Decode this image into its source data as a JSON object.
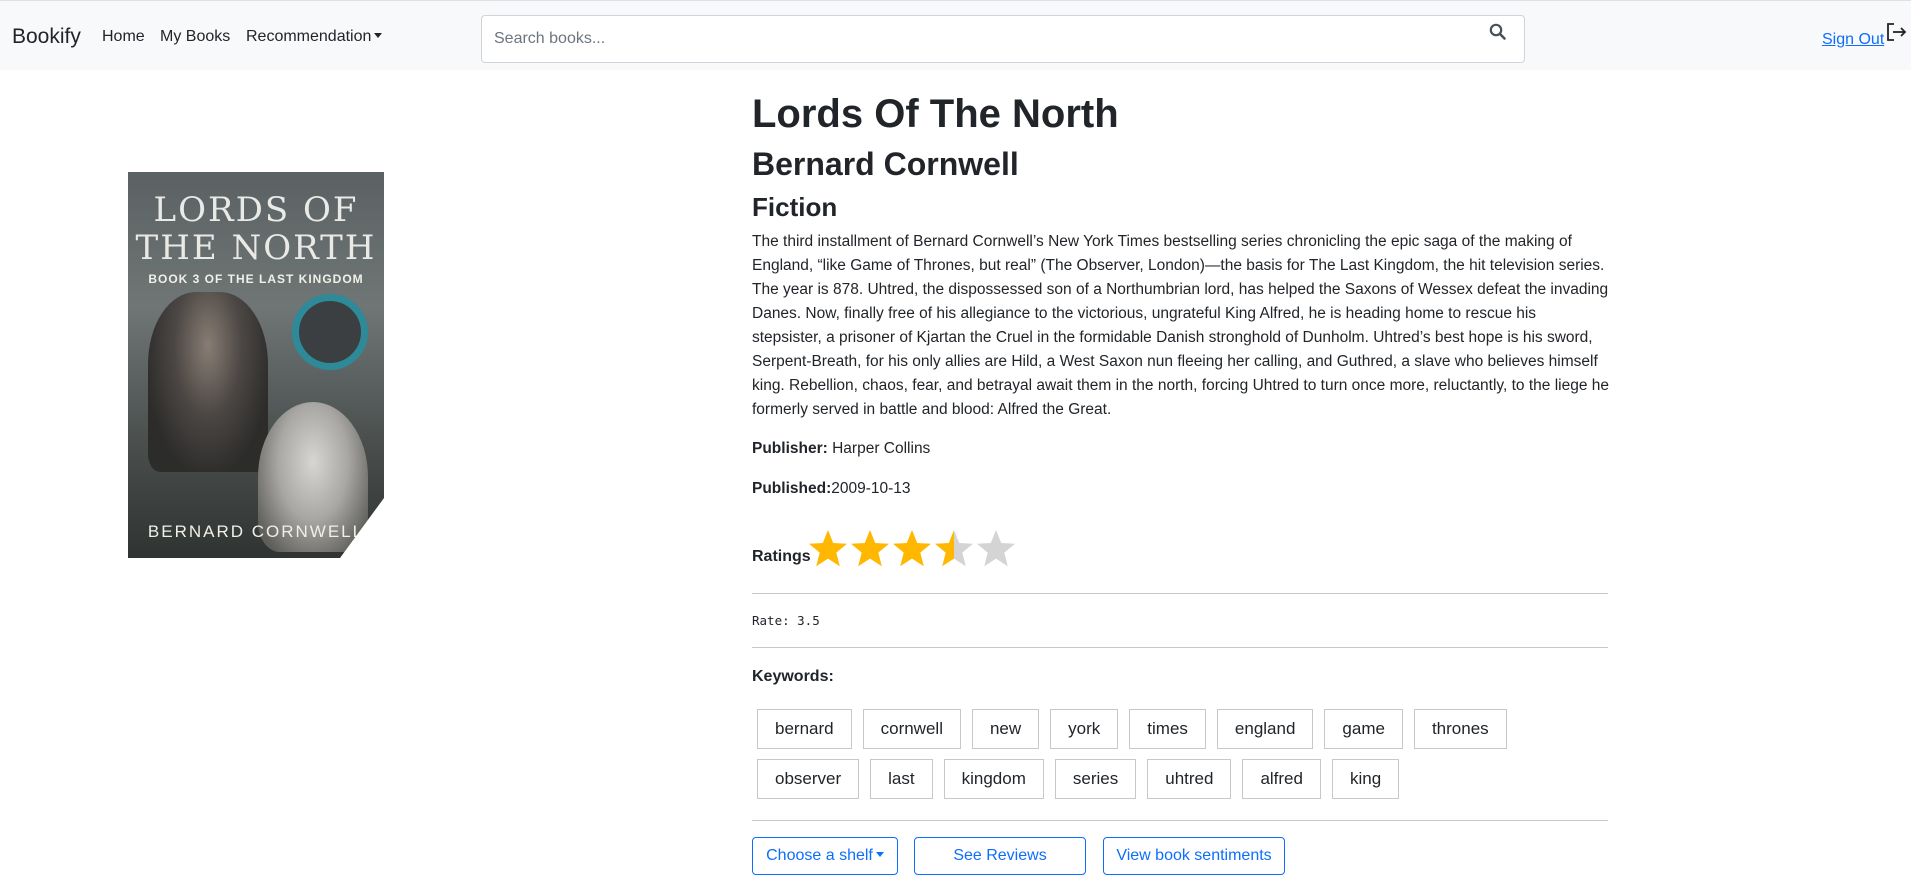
{
  "navbar": {
    "brand": "Bookify",
    "links": [
      {
        "label": "Home"
      },
      {
        "label": "My Books"
      },
      {
        "label": "Recommendation"
      }
    ],
    "search_placeholder": "Search books...",
    "signout_label": "Sign Out"
  },
  "cover": {
    "title_line1": "LORDS OF",
    "title_line2": "THE NORTH",
    "subtitle": "BOOK 3 OF THE LAST KINGDOM",
    "author": "BERNARD CORNWELL"
  },
  "book": {
    "title": "Lords Of The North",
    "author": "Bernard Cornwell",
    "genre": "Fiction",
    "description": "The third installment of Bernard Cornwell’s New York Times bestselling series chronicling the epic saga of the making of England, “like Game of Thrones, but real” (The Observer, London)—the basis for The Last Kingdom, the hit television series. The year is 878. Uhtred, the dispossessed son of a Northumbrian lord, has helped the Saxons of Wessex defeat the invading Danes. Now, finally free of his allegiance to the victorious, ungrateful King Alfred, he is heading home to rescue his stepsister, a prisoner of Kjartan the Cruel in the formidable Danish stronghold of Dunholm. Uhtred’s best hope is his sword, Serpent-Breath, for his only allies are Hild, a West Saxon nun fleeing her calling, and Guthred, a slave who believes himself king. Rebellion, chaos, fear, and betrayal await them in the north, forcing Uhtred to turn once more, reluctantly, to the liege he formerly served in battle and blood: Alfred the Great.",
    "publisher_label": "Publisher:",
    "publisher": "Harper Collins",
    "published_label": "Published:",
    "published": "2009-10-13"
  },
  "ratings": {
    "label": "Ratings",
    "value": 3.5,
    "max": 5,
    "star_color": "#ffb700",
    "empty_color": "#d4d4d4",
    "rate_text": "Rate: 3.5"
  },
  "keywords": {
    "label": "Keywords:",
    "row1": [
      "bernard",
      "cornwell",
      "new",
      "york",
      "times",
      "england",
      "game",
      "thrones"
    ],
    "row2": [
      "observer",
      "last",
      "kingdom",
      "series",
      "uhtred",
      "alfred",
      "king"
    ]
  },
  "actions": {
    "shelf_label": "Choose a shelf",
    "reviews_label": "See Reviews",
    "sentiments_label": "View book sentiments"
  },
  "colors": {
    "primary": "#0d6efd",
    "navbar_bg": "#f8f9fa"
  }
}
